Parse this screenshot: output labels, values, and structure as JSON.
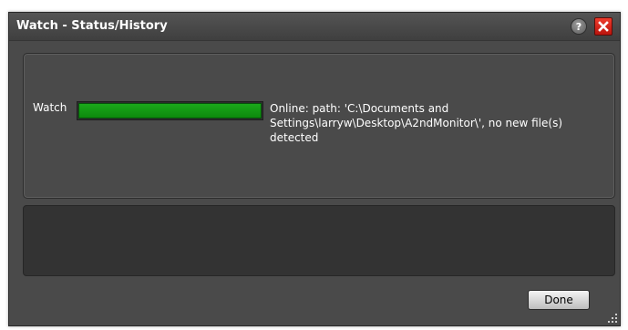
{
  "window": {
    "title": "Watch - Status/History"
  },
  "titlebar": {
    "help_icon": "question-icon",
    "help_glyph": "?",
    "close_icon": "close-icon"
  },
  "status": {
    "label": "Watch",
    "progress_fraction": 1.0,
    "progress_color": "#129a12",
    "message": "Online: path: 'C:\\Documents and Settings\\larryw\\Desktop\\A2ndMonitor\\', no new file(s) detected"
  },
  "history": {
    "entries": []
  },
  "footer": {
    "done_label": "Done",
    "resize_icon": "resize-grip-icon"
  },
  "colors": {
    "window_bg": "#4a4a4a",
    "history_bg": "#333333",
    "close_red": "#d9261c"
  }
}
